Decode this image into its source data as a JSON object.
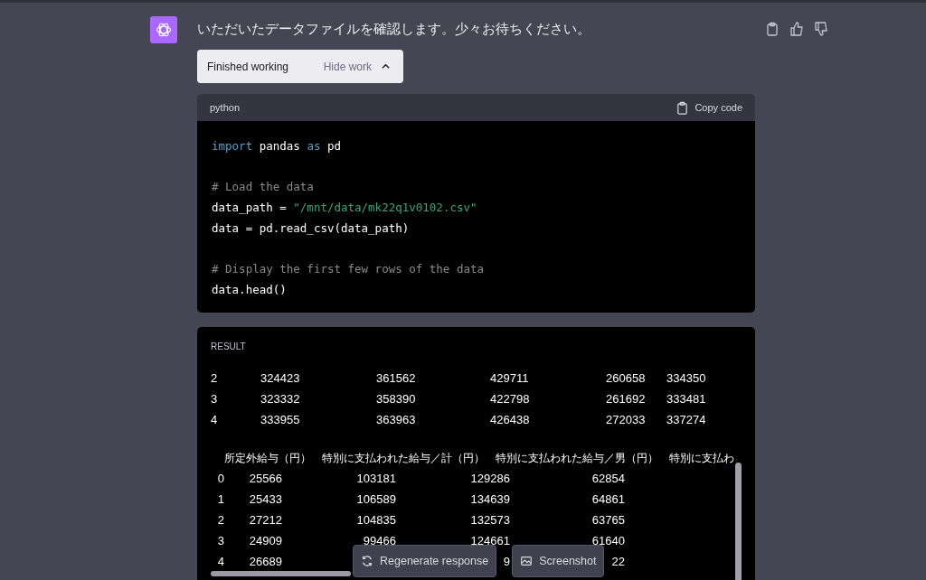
{
  "message": {
    "text": "いただいたデータファイルを確認します。少々お待ちください。"
  },
  "work_toggle": {
    "status": "Finished working",
    "action": "Hide work",
    "expanded": true
  },
  "code_block": {
    "language": "python",
    "copy_label": "Copy code",
    "blocks": [
      [
        [
          {
            "t": "import",
            "kind": "keyword"
          },
          {
            "t": " pandas ",
            "kind": "plain"
          },
          {
            "t": "as",
            "kind": "keyword"
          },
          {
            "t": " pd",
            "kind": "plain"
          }
        ]
      ],
      [
        [
          {
            "t": "# Load the data",
            "kind": "comment"
          }
        ],
        [
          {
            "t": "data_path = ",
            "kind": "plain"
          },
          {
            "t": "\"/mnt/data/mk22q1v0102.csv\"",
            "kind": "string"
          }
        ],
        [
          {
            "t": "data = pd.read_csv(data_path)",
            "kind": "plain"
          }
        ]
      ],
      [
        [
          {
            "t": "# Display the first few rows of the data",
            "kind": "comment"
          }
        ],
        [
          {
            "t": "data.head()",
            "kind": "plain"
          }
        ]
      ]
    ]
  },
  "result": {
    "label": "RESULT",
    "table_1": {
      "rows": [
        [
          "2",
          "324423",
          "361562",
          "429711",
          "260658",
          "334350"
        ],
        [
          "3",
          "323332",
          "358390",
          "422798",
          "261692",
          "333481"
        ],
        [
          "4",
          "333955",
          "363963",
          "426438",
          "272033",
          "337274"
        ]
      ]
    },
    "table_2": {
      "headers": [
        "所定外給与（円）",
        "特別に支払われた給与／計（円）",
        "特別に支払われた給与／男（円）",
        "特別に支払わ"
      ],
      "rows": [
        [
          "0",
          "25566",
          "103181",
          "129286",
          "62854"
        ],
        [
          "1",
          "25433",
          "106589",
          "134639",
          "64861"
        ],
        [
          "2",
          "27212",
          "104835",
          "132573",
          "63765"
        ],
        [
          "3",
          "24909",
          "99466",
          "124661",
          "61640"
        ],
        [
          "4",
          "26689",
          null,
          "9",
          "22"
        ]
      ]
    }
  },
  "footer_buttons": [
    {
      "label": "Regenerate response",
      "kind": "regenerate"
    },
    {
      "label": "Screenshot",
      "kind": "screenshot"
    }
  ]
}
